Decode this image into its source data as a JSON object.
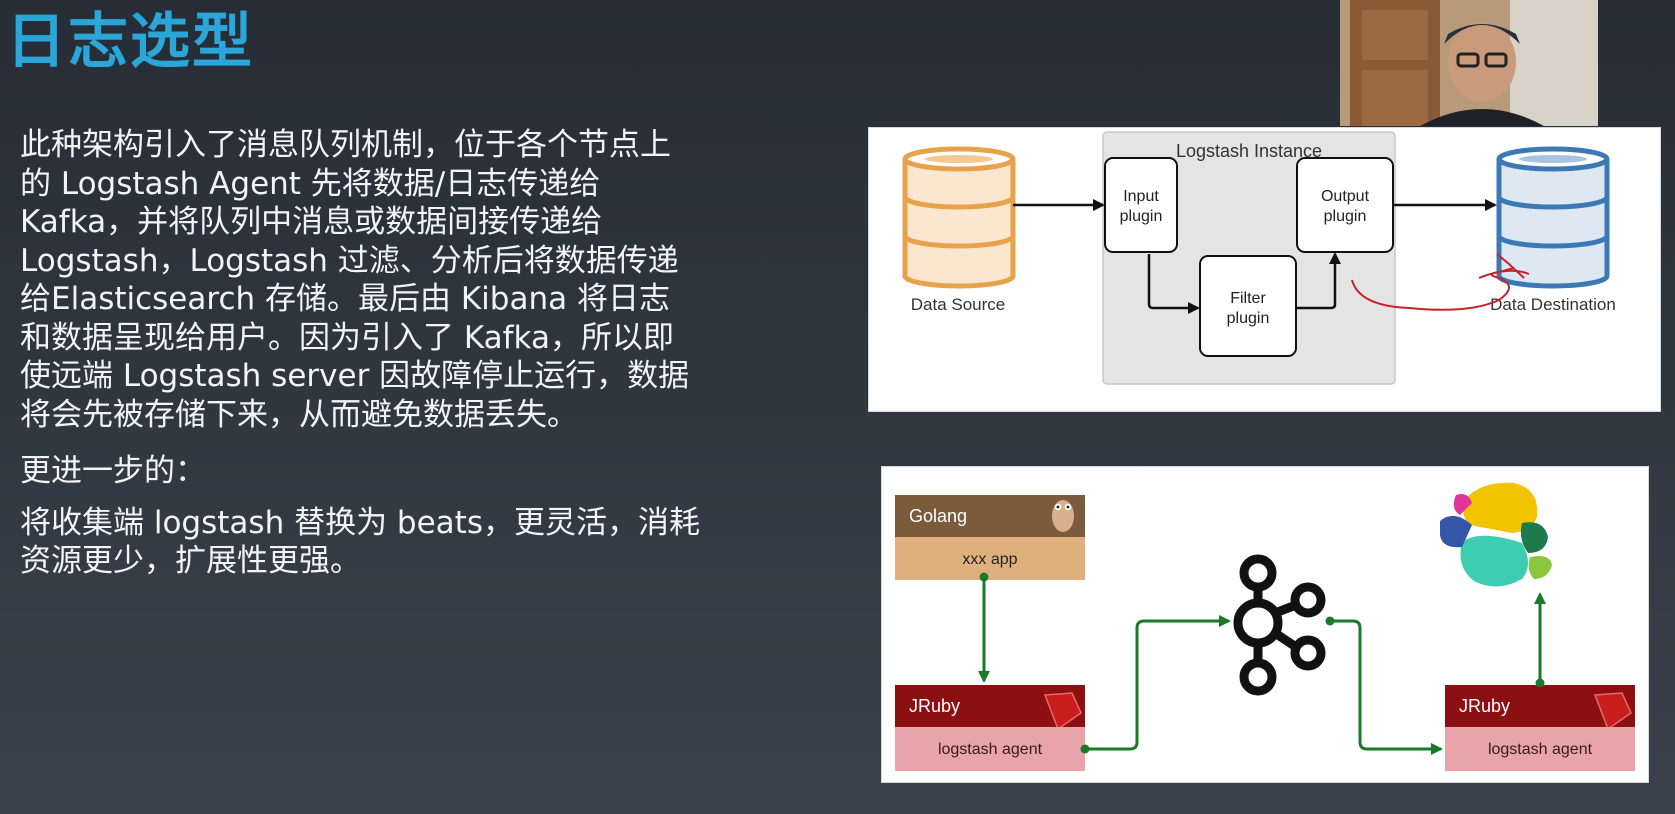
{
  "slide": {
    "title": "日志选型",
    "paragraphs": [
      "此种架构引入了消息队列机制，位于各个节点上的 Logstash Agent 先将数据/日志传递给 Kafka，并将队列中消息或数据间接传递给 Logstash，Logstash 过滤、分析后将数据传递给Elasticsearch 存储。最后由 Kibana 将日志和数据呈现给用户。因为引入了 Kafka，所以即使远端 Logstash server 因故障停止运行，数据将会先被存储下来，从而避免数据丢失。",
      "更进一步的：",
      "将收集端 logstash 替换为 beats，更灵活，消耗资源更少，扩展性更强。"
    ]
  },
  "diagram_logstash": {
    "instance_label": "Logstash Instance",
    "input_plugin": [
      "Input",
      "plugin"
    ],
    "filter_plugin": [
      "Filter",
      "plugin"
    ],
    "output_plugin": [
      "Output",
      "plugin"
    ],
    "data_source": "Data Source",
    "data_destination": "Data Destination",
    "colors": {
      "source": "#e8a24a",
      "destination": "#3c78b4",
      "annotation": "#c8202a"
    }
  },
  "diagram_pipeline": {
    "golang_header": "Golang",
    "golang_app": "xxx app",
    "jruby_left_header": "JRuby",
    "jruby_left_body": "logstash agent",
    "jruby_right_header": "JRuby",
    "jruby_right_body": "logstash agent",
    "colors": {
      "arrow": "#1a7a2a",
      "jruby_header": "#8c0f12",
      "jruby_body": "#e8a4aa",
      "golang_header": "#7c5a3c",
      "golang_body": "#e0b07c"
    }
  },
  "icons": {
    "webcam": "presenter-webcam",
    "gopher": "gopher-icon",
    "ruby": "ruby-icon",
    "kafka": "kafka-icon",
    "elastic": "elastic-icon"
  }
}
